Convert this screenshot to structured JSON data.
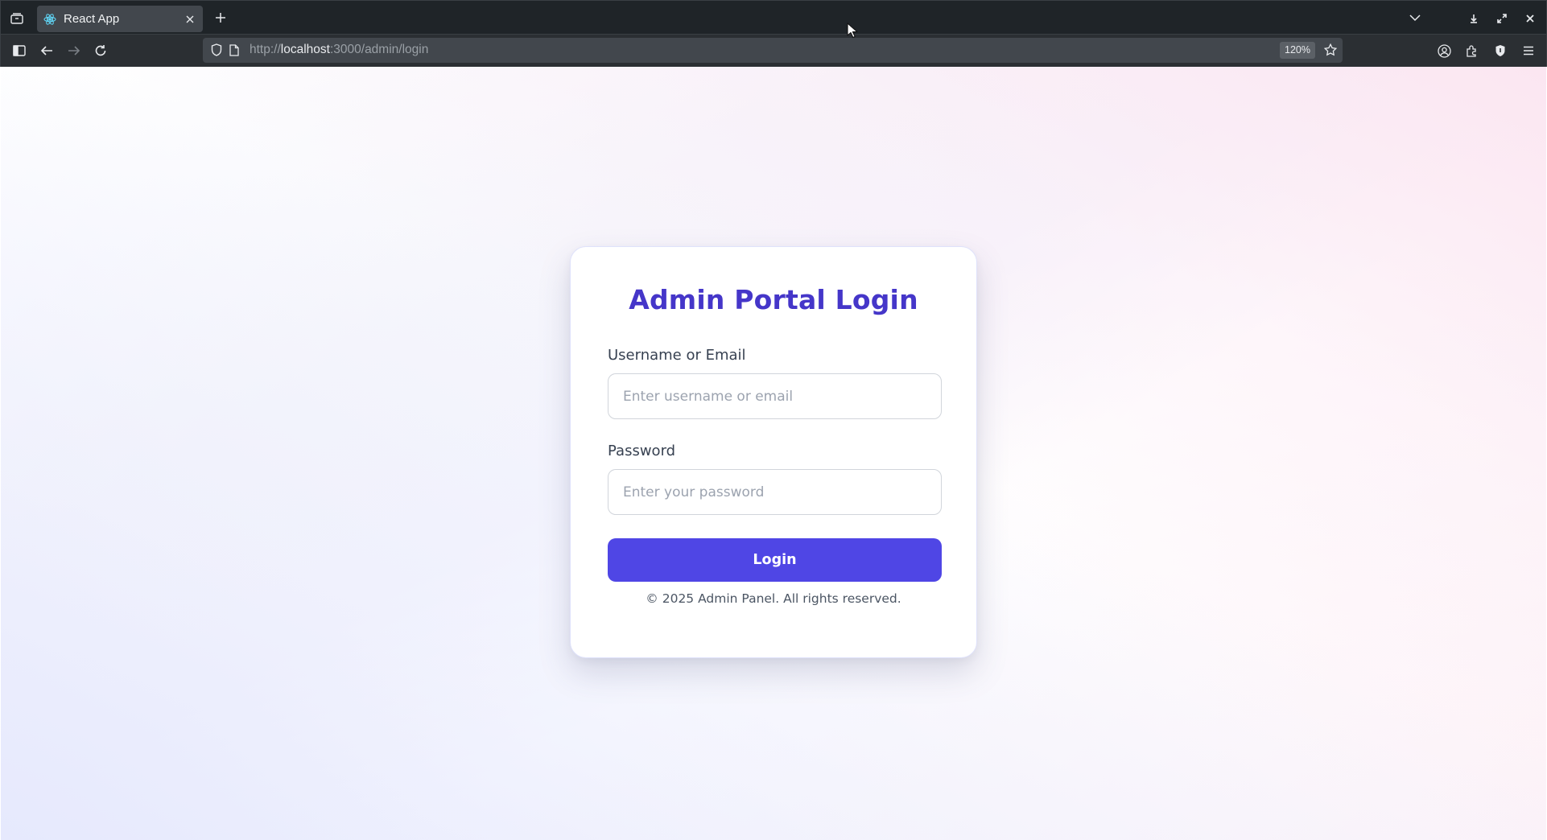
{
  "browser": {
    "tab": {
      "title": "React App"
    },
    "url": {
      "scheme": "http://",
      "host": "localhost",
      "rest": ":3000/admin/login"
    },
    "zoom": "120%",
    "colors": {
      "tab_bar": "#1f2428",
      "toolbar": "#2b2f33",
      "urlbar": "#42474d"
    }
  },
  "login": {
    "title": "Admin Portal Login",
    "username": {
      "label": "Username or Email",
      "placeholder": "Enter username or email",
      "value": ""
    },
    "password": {
      "label": "Password",
      "placeholder": "Enter your password",
      "value": ""
    },
    "submit_label": "Login",
    "footer": "© 2025 Admin Panel. All rights reserved.",
    "colors": {
      "title": "#4536c9",
      "button": "#4f46e5",
      "label": "#374151"
    }
  },
  "icons": {
    "tab_bar": [
      "tab-overview-icon",
      "react-favicon-icon",
      "close-icon",
      "new-tab-plus-icon",
      "list-all-tabs-chevron-icon",
      "minimize-icon",
      "restore-icon",
      "window-close-icon"
    ],
    "toolbar": [
      "sidebar-icon",
      "back-arrow-icon",
      "forward-arrow-icon",
      "reload-icon",
      "shield-icon",
      "page-icon",
      "star-bookmark-icon",
      "account-icon",
      "extensions-icon",
      "privacy-shield-icon",
      "menu-hamburger-icon"
    ]
  }
}
